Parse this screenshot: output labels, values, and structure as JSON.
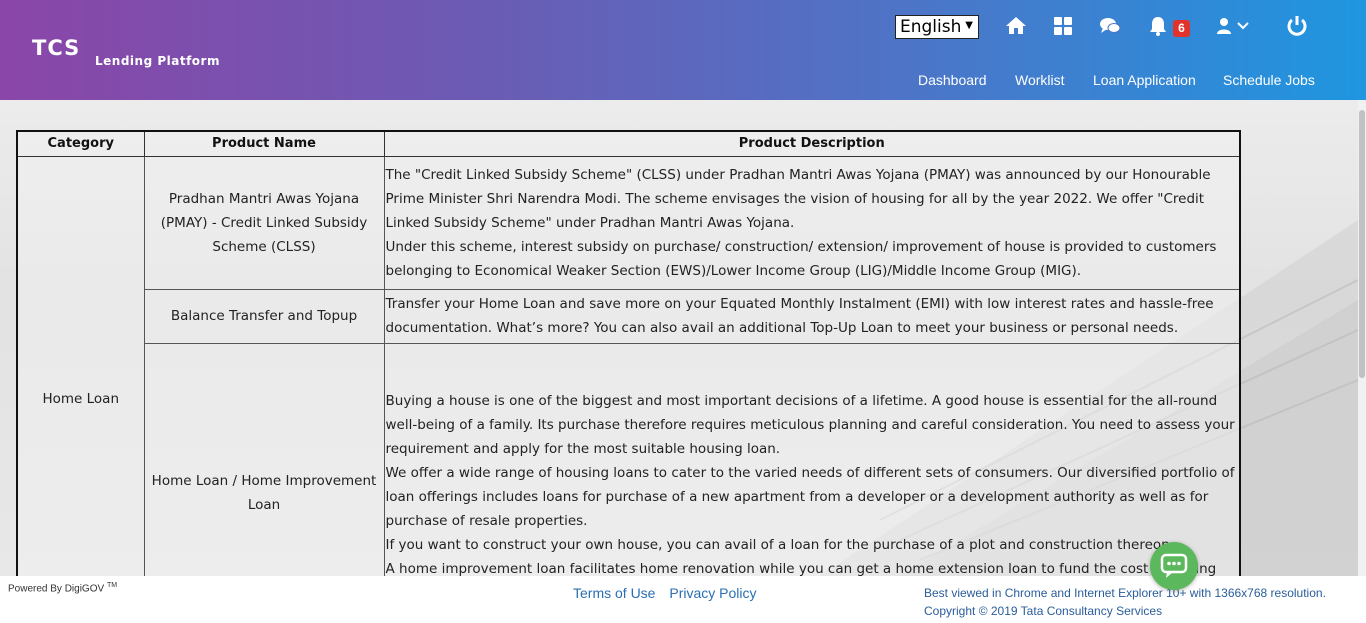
{
  "header": {
    "logo_main": "TCS",
    "logo_sub": "Lending Platform",
    "language": "English",
    "notification_count": "6",
    "nav": [
      "Dashboard",
      "Worklist",
      "Loan Application",
      "Schedule Jobs"
    ],
    "icons": [
      "home-icon",
      "dashboard-grid-icon",
      "chat-icon",
      "bell-icon",
      "user-icon",
      "power-icon"
    ]
  },
  "table": {
    "headers": [
      "Category",
      "Product Name",
      "Product Description"
    ],
    "category": "Home Loan",
    "rows": [
      {
        "product": "Pradhan Mantri Awas Yojana (PMAY) - Credit Linked Subsidy Scheme (CLSS)",
        "description": [
          "The \"Credit Linked Subsidy Scheme\" (CLSS) under Pradhan Mantri Awas Yojana (PMAY) was announced by our Honourable Prime Minister Shri Narendra Modi. The scheme envisages the vision of housing for all by the year 2022. We offer \"Credit Linked Subsidy Scheme\" under Pradhan Mantri Awas Yojana.",
          "Under this scheme, interest subsidy on purchase/ construction/ extension/ improvement of house is provided to customers belonging to Economical Weaker Section (EWS)/Lower Income Group (LIG)/Middle Income Group (MIG)."
        ]
      },
      {
        "product": "Balance Transfer and Topup",
        "description": [
          "Transfer your Home Loan and save more on your Equated Monthly Instalment (EMI) with low interest rates and hassle-free documentation. What’s more? You can also avail an additional Top-Up Loan to meet your business or personal needs."
        ]
      },
      {
        "product": "Home Loan / Home Improvement Loan",
        "description": [
          "Buying a house is one of the biggest and most important decisions of a lifetime. A good house is essential for the all-round well-being of a family. Its purchase therefore requires meticulous planning and careful consideration. You need to assess your requirement and apply for the most suitable housing loan.",
          "We offer a wide range of housing loans to cater to the varied needs of different sets of consumers. Our diversified portfolio of loan offerings includes loans for purchase of a new apartment from a developer or a development authority as well as for purchase of resale properties.",
          "If you want to construct your own house, you can avail of a loan for the purchase of a plot and construction thereon.",
          "A home improvement loan facilitates home renovation while you can get a home extension loan to fund the cost of adding more floors or rooms to your existing house."
        ]
      }
    ]
  },
  "footer": {
    "powered_by": "Powered By DigiGOV",
    "powered_tm": "TM",
    "terms": "Terms of Use",
    "privacy": "Privacy Policy",
    "best_viewed": "Best viewed in Chrome and Internet Explorer 10+ with 1366x768 resolution.",
    "copyright": "Copyright © 2019 Tata Consultancy Services"
  },
  "colors": {
    "header_start": "#8a46a8",
    "header_end": "#1f96e0",
    "badge": "#e2322c",
    "chat_button": "#5cb85c",
    "link": "#2a6fb3"
  }
}
